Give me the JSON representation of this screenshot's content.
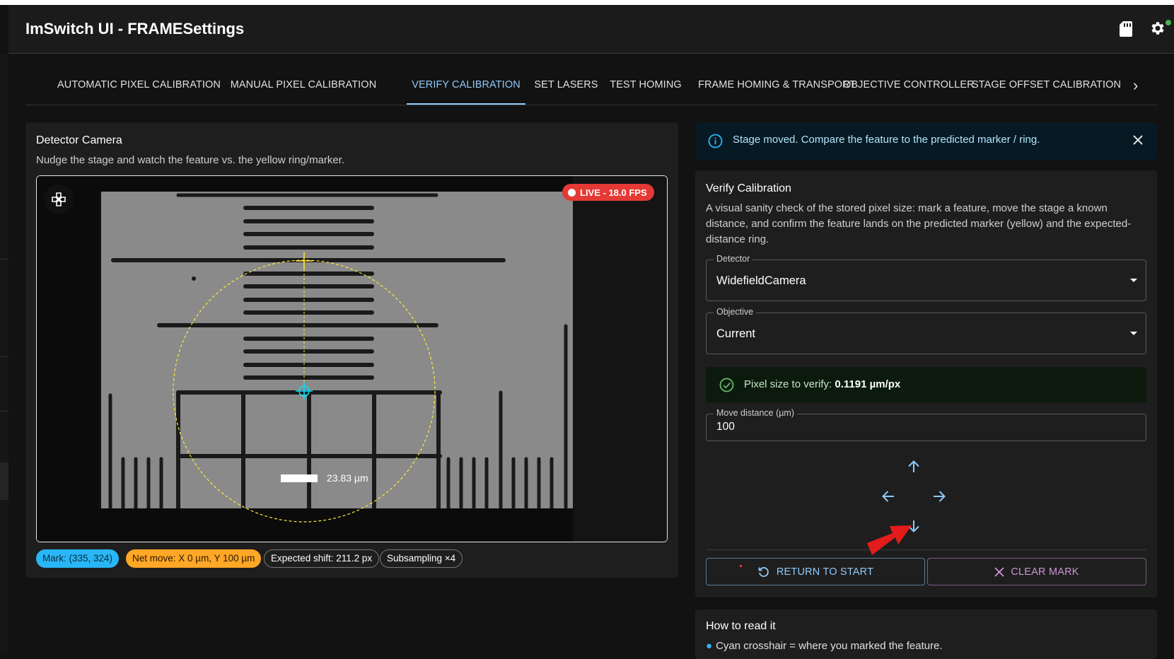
{
  "app": {
    "title": "ImSwitch UI - FRAMESettings"
  },
  "tabs": [
    {
      "label": "AUTOMATIC PIXEL CALIBRATION"
    },
    {
      "label": "MANUAL PIXEL CALIBRATION"
    },
    {
      "label": "VERIFY CALIBRATION",
      "active": true
    },
    {
      "label": "SET LASERS"
    },
    {
      "label": "TEST HOMING"
    },
    {
      "label": "FRAME HOMING & TRANSPORT"
    },
    {
      "label": "OBJECTIVE CONTROLLER"
    },
    {
      "label": "STAGE OFFSET CALIBRATION"
    }
  ],
  "detector_panel": {
    "title": "Detector Camera",
    "subtitle": "Nudge the stage and watch the feature vs. the yellow ring/marker.",
    "live_badge": "LIVE - 18.0 FPS",
    "scale_bar_label": "23.83 µm",
    "chips": {
      "mark": "Mark: (335, 324)",
      "net_move": "Net move: X 0 µm, Y 100 µm",
      "expected_shift": "Expected shift: 211.2 px",
      "subsampling": "Subsampling ×4"
    }
  },
  "alert": {
    "message": "Stage moved. Compare the feature to the predicted marker / ring."
  },
  "verify": {
    "title": "Verify Calibration",
    "description": "A visual sanity check of the stored pixel size: mark a feature, move the stage a known distance, and confirm the feature lands on the predicted marker (yellow) and the expected-distance ring.",
    "detector": {
      "label": "Detector",
      "value": "WidefieldCamera"
    },
    "objective": {
      "label": "Objective",
      "value": "Current"
    },
    "pixel_size": {
      "prefix": "Pixel size to verify:",
      "value": "0.1191 µm/px"
    },
    "move_distance": {
      "label": "Move distance (µm)",
      "value": "100"
    },
    "return_label": "RETURN TO START",
    "clear_label": "CLEAR MARK"
  },
  "how_to": {
    "title": "How to read it",
    "item1": "Cyan crosshair = where you marked the feature."
  },
  "colors": {
    "accent": "#90caf9",
    "live": "#e53935",
    "chip_blue": "#29b6f6",
    "chip_orange": "#ffa726",
    "ring": "#ffeb3b",
    "mark": "#00e5ff"
  },
  "icons": [
    "sd-card-icon",
    "gear-icon",
    "gamepad-icon",
    "info-icon",
    "close-icon",
    "check-circle-icon",
    "arrow-up-icon",
    "arrow-left-icon",
    "arrow-right-icon",
    "arrow-down-icon",
    "undo-icon",
    "clear-icon"
  ]
}
